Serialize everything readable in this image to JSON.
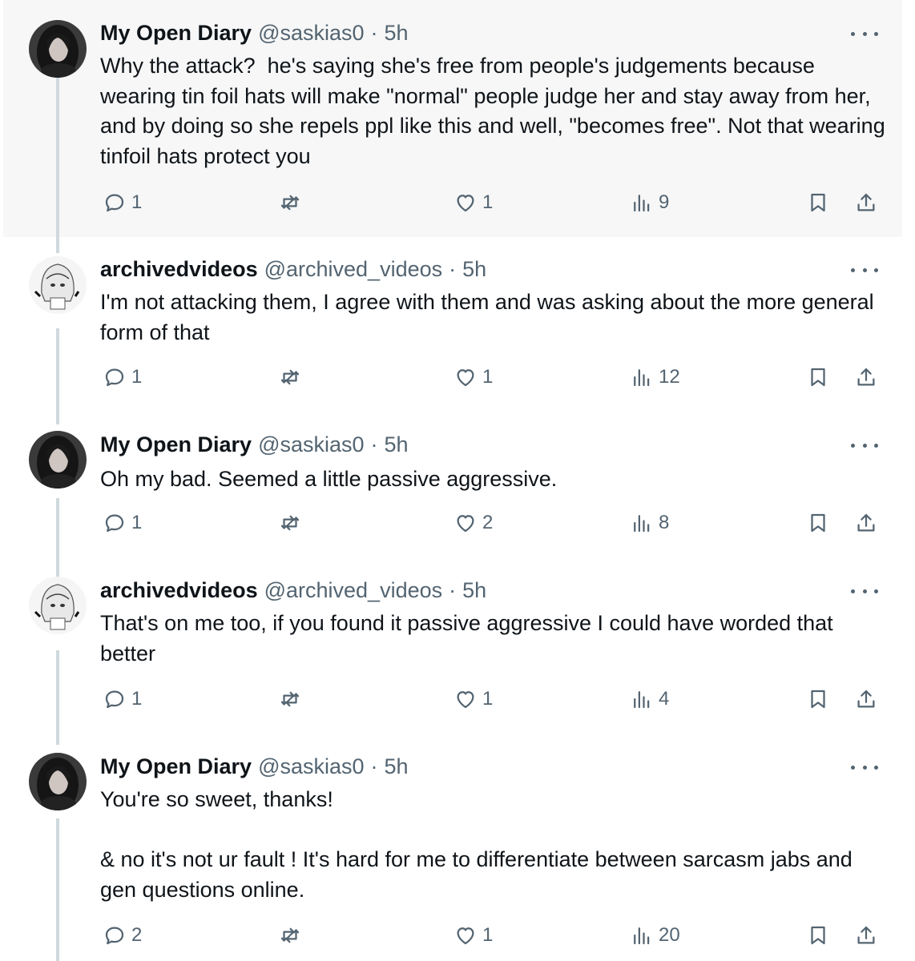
{
  "tweets": [
    {
      "author": "My Open Diary",
      "handle": "@saskias0",
      "sep": "·",
      "time": "5h",
      "text": "Why the attack?  he's saying she's free from people's judgements because wearing tin foil hats will make \"normal\" people judge her and stay away from her, and by doing so she repels ppl like this and well, \"becomes free\". Not that wearing tinfoil hats protect you",
      "replies": "1",
      "reposts": "",
      "likes": "1",
      "views": "9",
      "avatar": "dark-portrait"
    },
    {
      "author": "archivedvideos",
      "handle": "@archived_videos",
      "sep": "·",
      "time": "5h",
      "text": "I'm not attacking them, I agree with them and was asking about the more general form of that",
      "replies": "1",
      "reposts": "",
      "likes": "1",
      "views": "12",
      "avatar": "anime-sketch"
    },
    {
      "author": "My Open Diary",
      "handle": "@saskias0",
      "sep": "·",
      "time": "5h",
      "text": "Oh my bad. Seemed a little passive aggressive.",
      "replies": "1",
      "reposts": "",
      "likes": "2",
      "views": "8",
      "avatar": "dark-portrait"
    },
    {
      "author": "archivedvideos",
      "handle": "@archived_videos",
      "sep": "·",
      "time": "5h",
      "text": "That's on me too, if you found it passive aggressive I could have worded that better",
      "replies": "1",
      "reposts": "",
      "likes": "1",
      "views": "4",
      "avatar": "anime-sketch"
    },
    {
      "author": "My Open Diary",
      "handle": "@saskias0",
      "sep": "·",
      "time": "5h",
      "text": "You're so sweet, thanks!\n\n& no it's not ur fault ! It's hard for me to differentiate between sarcasm jabs and gen questions online.",
      "replies": "2",
      "reposts": "",
      "likes": "1",
      "views": "20",
      "avatar": "dark-portrait"
    }
  ],
  "icons": {
    "reply": "reply-icon",
    "repost": "repost-icon",
    "like": "heart-icon",
    "views": "views-icon",
    "bookmark": "bookmark-icon",
    "share": "share-icon",
    "more": "more-icon"
  },
  "colors": {
    "text": "#0f1419",
    "secondary": "#536471",
    "thread_line": "#cfd9de",
    "highlight_bg": "#f7f7f7"
  }
}
